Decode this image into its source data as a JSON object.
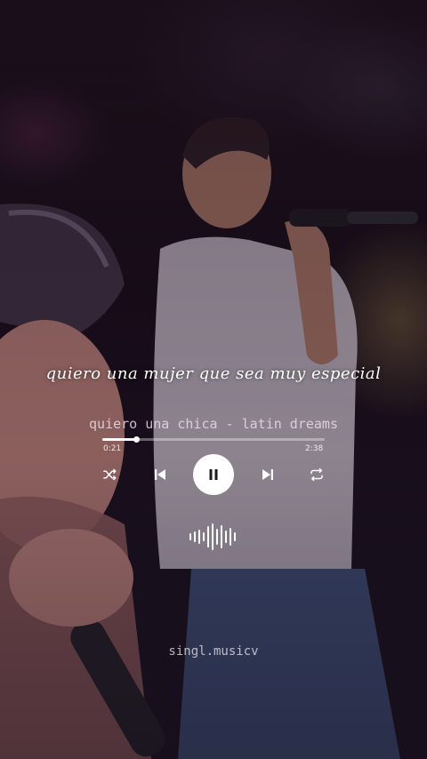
{
  "lyric": "quiero una mujer que sea muy especial",
  "player": {
    "song_title": "quiero una chica - latin dreams",
    "elapsed": "0:21",
    "total": "2:38",
    "progress_fraction": 0.15,
    "icons": [
      "shuffle-icon",
      "previous-icon",
      "pause-icon",
      "next-icon",
      "repeat-icon",
      "soundwave-icon"
    ]
  },
  "handle": "singl.musicv"
}
